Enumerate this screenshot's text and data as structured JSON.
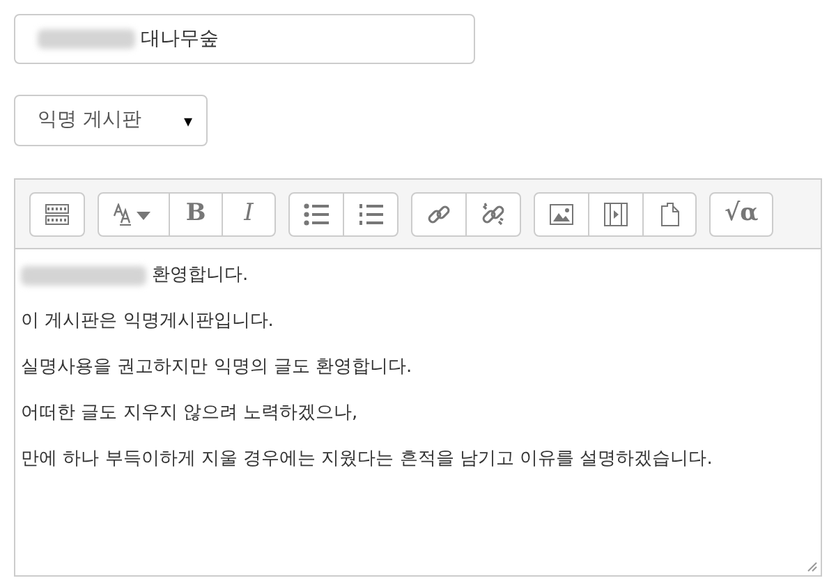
{
  "name_field": {
    "redacted_prefix": true,
    "value": "대나무숲"
  },
  "board_select": {
    "value": "익명 게시판",
    "caret": "▾"
  },
  "toolbar": [
    [
      {
        "kind": "grid"
      }
    ],
    [
      {
        "kind": "font"
      },
      {
        "kind": "bold",
        "label": "B"
      },
      {
        "kind": "italic",
        "label": "I"
      }
    ],
    [
      {
        "kind": "bullets"
      },
      {
        "kind": "numbers"
      }
    ],
    [
      {
        "kind": "link"
      },
      {
        "kind": "unlink"
      }
    ],
    [
      {
        "kind": "image"
      },
      {
        "kind": "video"
      },
      {
        "kind": "file"
      }
    ],
    [
      {
        "kind": "math",
        "label": "√α"
      }
    ]
  ],
  "editor_lines": [
    {
      "redacted_prefix": true,
      "text": "환영합니다."
    },
    {
      "redacted_prefix": false,
      "text": "이 게시판은 익명게시판입니다."
    },
    {
      "redacted_prefix": false,
      "text": "실명사용을 권고하지만 익명의 글도 환영합니다."
    },
    {
      "redacted_prefix": false,
      "text": "어떠한 글도 지우지 않으려 노력하겠으나,"
    },
    {
      "redacted_prefix": false,
      "text": "만에 하나 부득이하게 지울 경우에는 지웠다는 흔적을 남기고 이유를 설명하겠습니다."
    }
  ]
}
